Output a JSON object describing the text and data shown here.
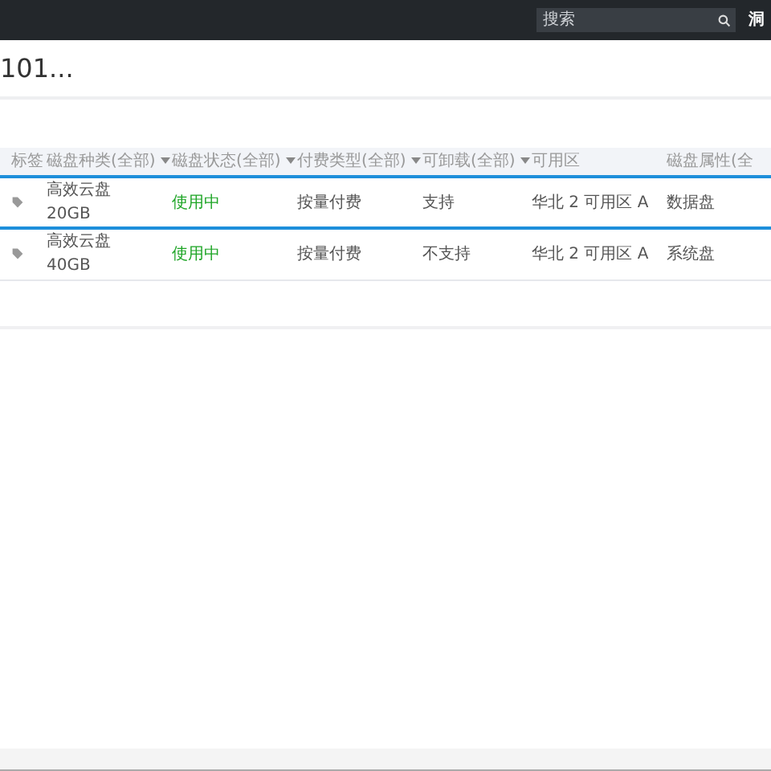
{
  "topbar": {
    "search": {
      "placeholder": "搜索"
    },
    "user_text": "洞"
  },
  "page": {
    "title": "101..."
  },
  "table": {
    "columns": [
      {
        "label": "标签",
        "filter": false
      },
      {
        "label": "磁盘种类(全部)",
        "filter": true
      },
      {
        "label": "磁盘状态(全部)",
        "filter": true
      },
      {
        "label": "付费类型(全部)",
        "filter": true
      },
      {
        "label": "可卸载(全部)",
        "filter": true
      },
      {
        "label": "可用区",
        "filter": false
      },
      {
        "label": "磁盘属性(全",
        "filter": false
      }
    ],
    "rows": [
      {
        "selected": true,
        "disk_type": "高效云盘",
        "size": "20GB",
        "status": "使用中",
        "billing": "按量付费",
        "detachable": "支持",
        "zone": "华北 2 可用区 A",
        "attribute": "数据盘"
      },
      {
        "selected": false,
        "disk_type": "高效云盘",
        "size": "40GB",
        "status": "使用中",
        "billing": "按量付费",
        "detachable": "不支持",
        "zone": "华北 2 可用区 A",
        "attribute": "系统盘"
      }
    ]
  }
}
